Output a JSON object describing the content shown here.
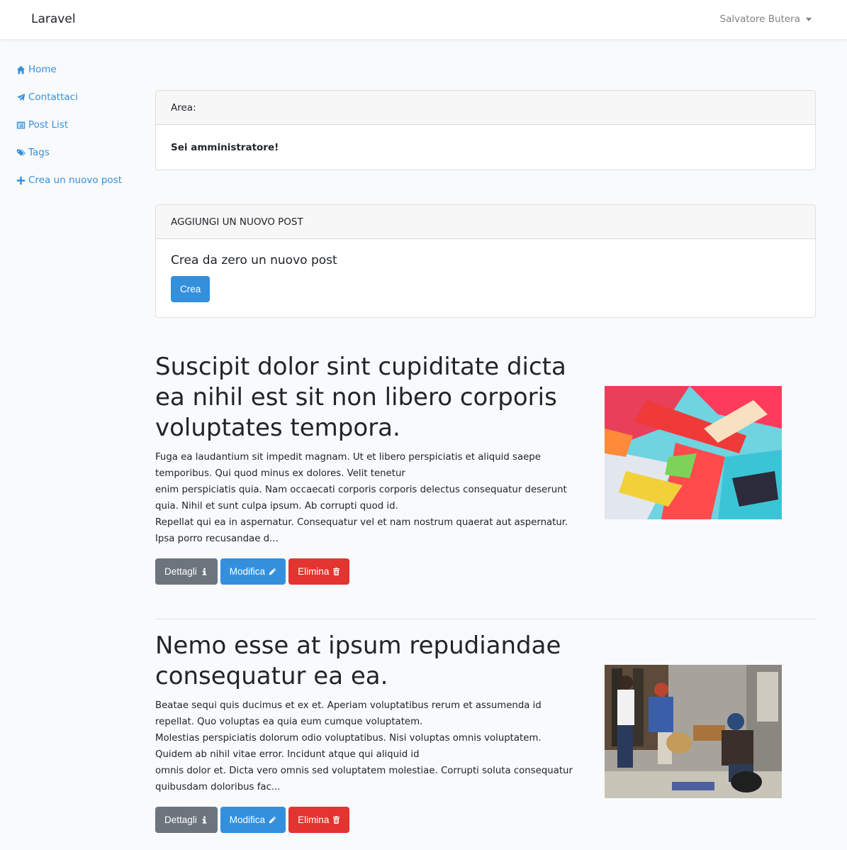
{
  "navbar": {
    "brand": "Laravel",
    "user_name": "Salvatore Butera"
  },
  "sidebar": {
    "items": [
      {
        "label": "Home",
        "icon": "home-icon"
      },
      {
        "label": "Contattaci",
        "icon": "paper-plane-icon"
      },
      {
        "label": "Post List",
        "icon": "list-alt-icon"
      },
      {
        "label": "Tags",
        "icon": "tags-icon"
      },
      {
        "label": "Crea un nuovo post",
        "icon": "plus-icon"
      }
    ]
  },
  "area_card": {
    "header": "Area:",
    "body": "Sei amministratore!"
  },
  "new_post_card": {
    "header": "AGGIUNGI UN NUOVO POST",
    "lead": "Crea da zero un nuovo post",
    "button": "Crea"
  },
  "posts": [
    {
      "title": "Suscipit dolor sint cupiditate dicta ea nihil est sit non libero corporis voluptates tempora.",
      "excerpt_lines": [
        "Fuga ea laudantium sit impedit magnam. Ut et libero perspiciatis et aliquid saepe temporibus. Qui quod minus ex dolores. Velit tenetur",
        "enim perspiciatis quia. Nam occaecati corporis corporis delectus consequatur deserunt quia. Nihil et sunt culpa ipsum. Ab corrupti quod id.",
        "Repellat qui ea in aspernatur. Consequatur vel et nam nostrum quaerat aut aspernatur. Ipsa porro recusandae d..."
      ],
      "image": "abstract-paint-image"
    },
    {
      "title": "Nemo esse at ipsum repudiandae consequatur ea ea.",
      "excerpt_lines": [
        "Beatae sequi quis ducimus et ex et. Aperiam voluptatibus rerum et assumenda id repellat. Quo voluptas ea quia eum cumque voluptatem.",
        "Molestias perspiciatis dolorum odio voluptatibus. Nisi voluptas omnis voluptatem. Quidem ab nihil vitae error. Incidunt atque qui aliquid id",
        "omnis dolor et. Dicta vero omnis sed voluptatem molestiae. Corrupti soluta consequatur quibusdam doloribus fac..."
      ],
      "image": "street-scene-image"
    }
  ],
  "post_actions": {
    "details": "Dettagli",
    "edit": "Modifica",
    "delete": "Elimina"
  },
  "colors": {
    "primary": "#3490dc",
    "secondary": "#6c757d",
    "danger": "#e3342f",
    "background": "#f8fafc"
  }
}
